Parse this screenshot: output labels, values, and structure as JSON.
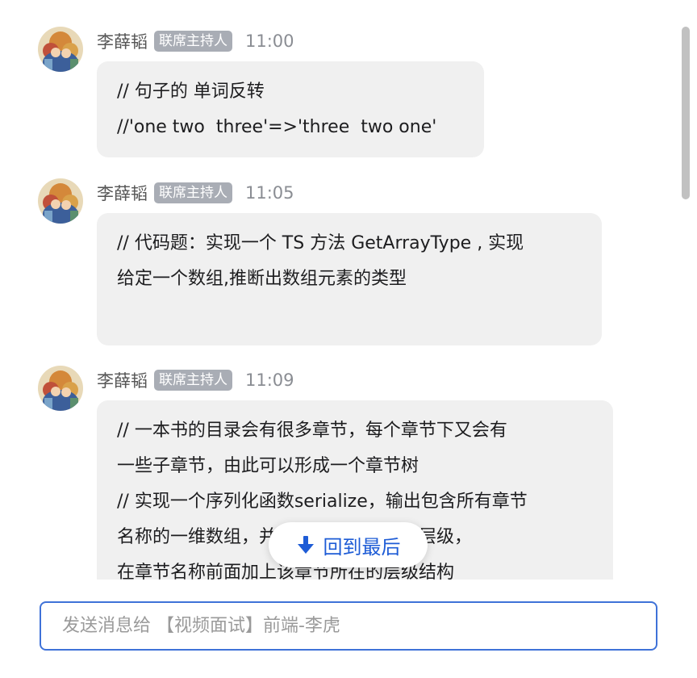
{
  "messages": [
    {
      "sender": "李薛韬",
      "role": "联席主持人",
      "time": "11:00",
      "lines": [
        "// 句子的 单词反转",
        "//'one two  three'=>'three  two one'"
      ]
    },
    {
      "sender": "李薛韬",
      "role": "联席主持人",
      "time": "11:05",
      "lines": [
        "// 代码题：实现一个 TS 方法 GetArrayType , 实现",
        "给定一个数组,推断出数组元素的类型"
      ]
    },
    {
      "sender": "李薛韬",
      "role": "联席主持人",
      "time": "11:09",
      "lines": [
        "// 一本书的目录会有很多章节，每个章节下又会有",
        "一些子章节，由此可以形成一个章节树",
        "// 实现一个序列化函数serialize，输出包含所有章节",
        "名称的一维数组，并且标明章节所在的层级，",
        "在章节名称前面加上该章节所在的层级结构"
      ]
    }
  ],
  "jump_to_latest": {
    "label": "回到最后",
    "icon": "arrow-down-icon",
    "color": "#1e5cd6"
  },
  "composer": {
    "placeholder": "发送消息给 【视频面试】前端-李虎",
    "value": "",
    "border_color": "#3f72d8"
  },
  "colors": {
    "bubble": "#f0f0f0",
    "badge": "#a9adb5",
    "accent": "#1e5cd6"
  }
}
